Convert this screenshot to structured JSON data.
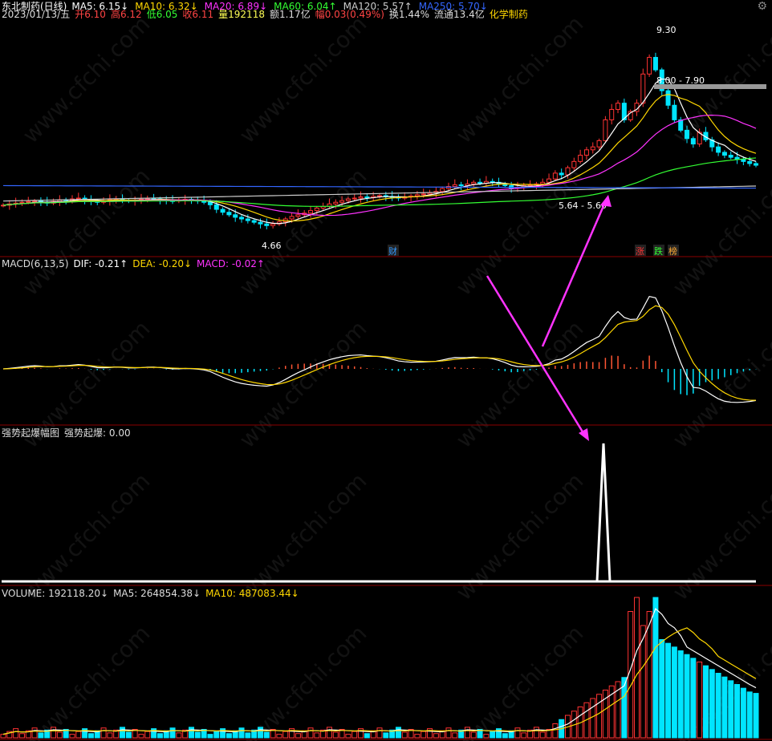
{
  "header": {
    "title": "东北制药(日线)",
    "ma_items": [
      {
        "label": "MA5: 6.15",
        "arrow": "↓",
        "color": "#ffffff"
      },
      {
        "label": "MA10: 6.32",
        "arrow": "↓",
        "color": "#ffd700"
      },
      {
        "label": "MA20: 6.89",
        "arrow": "↓",
        "color": "#ff33ff"
      },
      {
        "label": "MA60: 6.04",
        "arrow": "↑",
        "color": "#33ff33"
      },
      {
        "label": "MA120: 5.57",
        "arrow": "↑",
        "color": "#cccccc"
      },
      {
        "label": "MA250: 5.70",
        "arrow": "↓",
        "color": "#3366ff"
      }
    ],
    "info_items": [
      {
        "label": "2023/01/13/五",
        "color": "#dddddd"
      },
      {
        "label": "开6.10",
        "color": "#ff4444"
      },
      {
        "label": "高6.12",
        "color": "#ff4444"
      },
      {
        "label": "低6.05",
        "color": "#33ff33"
      },
      {
        "label": "收6.11",
        "color": "#ff4444"
      },
      {
        "label": "量192118",
        "color": "#ffff55"
      },
      {
        "label": "额1.17亿",
        "color": "#dddddd"
      },
      {
        "label": "幅0.03(0.49%)",
        "color": "#ff4444"
      },
      {
        "label": "换1.44%",
        "color": "#dddddd"
      },
      {
        "label": "流通13.4亿",
        "color": "#dddddd"
      },
      {
        "label": "化学制药",
        "color": "#ffd700"
      }
    ]
  },
  "price_annotations": {
    "high": "9.30",
    "range_high": "8.00 - 7.90",
    "range_low": "5.64 - 5.60",
    "low": "4.66",
    "markers": [
      {
        "label": "财",
        "color": "#3399ff"
      },
      {
        "label": "涨",
        "color": "#ff3333"
      },
      {
        "label": "跌",
        "color": "#33ff33"
      },
      {
        "label": "榜",
        "color": "#ffaa33"
      }
    ]
  },
  "macd_panel": {
    "items": [
      {
        "label": "MACD(6,13,5)",
        "arrow": "",
        "color": "#dddddd"
      },
      {
        "label": "DIF: -0.21",
        "arrow": "↑",
        "color": "#ffffff"
      },
      {
        "label": "DEA: -0.20",
        "arrow": "↓",
        "color": "#ffd700"
      },
      {
        "label": "MACD: -0.02",
        "arrow": "↑",
        "color": "#ff33ff"
      }
    ]
  },
  "signal_panel": {
    "items": [
      {
        "label": "强势起爆幅图",
        "color": "#dddddd"
      },
      {
        "label": "强势起爆: 0.00",
        "color": "#dddddd"
      }
    ]
  },
  "volume_panel": {
    "items": [
      {
        "label": "VOLUME: 192118.20",
        "arrow": "↓",
        "color": "#dddddd"
      },
      {
        "label": "MA5: 264854.38",
        "arrow": "↓",
        "color": "#dddddd"
      },
      {
        "label": "MA10: 487083.44",
        "arrow": "↓",
        "color": "#ffd700"
      }
    ]
  },
  "watermark": "www.cfchi.com",
  "chart_data": {
    "type": "candlestick",
    "title": "东北制药(日线)",
    "price_range": [
      4.3,
      9.5
    ],
    "ohlc": [],
    "seed_closes": [
      5.15,
      5.18,
      5.2,
      5.22,
      5.24,
      5.25,
      5.22,
      5.2,
      5.24,
      5.28,
      5.26,
      5.3,
      5.32,
      5.28,
      5.24,
      5.22,
      5.25,
      5.28,
      5.3,
      5.27,
      5.25,
      5.27,
      5.29,
      5.31,
      5.3,
      5.28,
      5.26,
      5.25,
      5.27,
      5.29,
      5.27,
      5.25,
      5.22,
      5.16,
      5.05,
      4.98,
      4.92,
      4.86,
      4.82,
      4.78,
      4.74,
      4.7,
      4.66,
      4.7,
      4.75,
      4.82,
      4.88,
      4.92,
      4.96,
      5.02,
      5.08,
      5.12,
      5.18,
      5.22,
      5.26,
      5.3,
      5.32,
      5.35,
      5.33,
      5.36,
      5.38,
      5.36,
      5.34,
      5.32,
      5.35,
      5.37,
      5.4,
      5.42,
      5.45,
      5.48,
      5.55,
      5.6,
      5.64,
      5.62,
      5.66,
      5.7,
      5.68,
      5.72,
      5.7,
      5.66,
      5.62,
      5.56,
      5.58,
      5.62,
      5.64,
      5.66,
      5.7,
      5.78,
      5.92,
      5.88,
      6.05,
      6.2,
      6.35,
      6.48,
      6.55,
      6.7,
      7.2,
      7.45,
      7.6,
      7.2,
      7.4,
      7.6,
      8.3,
      8.7,
      8.4,
      7.9,
      7.55,
      7.2,
      6.95,
      6.75,
      6.62,
      6.9,
      6.72,
      6.55,
      6.42,
      6.35,
      6.3,
      6.25,
      6.2,
      6.15,
      6.11
    ]
  }
}
